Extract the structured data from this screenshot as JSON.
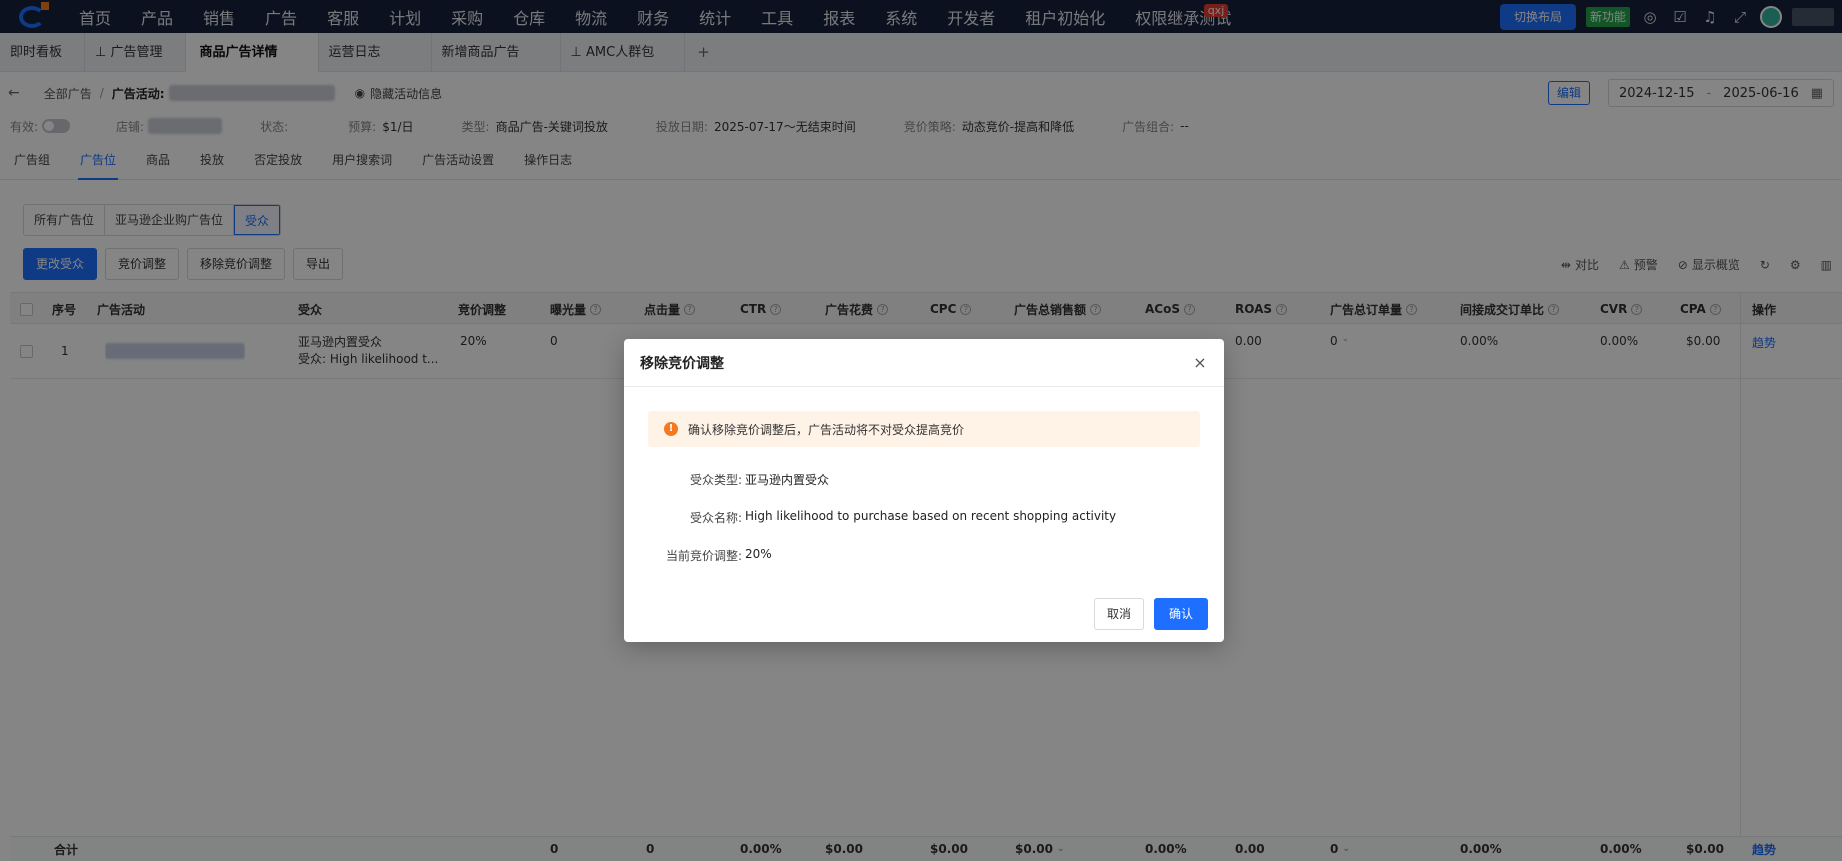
{
  "topnav": {
    "items": [
      "首页",
      "产品",
      "销售",
      "广告",
      "客服",
      "计划",
      "采购",
      "仓库",
      "物流",
      "财务",
      "统计",
      "工具",
      "报表",
      "系统",
      "开发者",
      "租户初始化",
      "权限继承测试"
    ],
    "badge": "qxj",
    "switch_layout": "切换布局",
    "new_feature": "新功能"
  },
  "tabs": [
    {
      "label": "即时看板"
    },
    {
      "label": "广告管理"
    },
    {
      "label": "商品广告详情"
    },
    {
      "label": "运营日志"
    },
    {
      "label": "新增商品广告"
    },
    {
      "label": "AMC人群包"
    }
  ],
  "tab_plus": "+",
  "breadcrumb": {
    "back": "←",
    "all_ads": "全部广告",
    "sep": "/",
    "campaign_label": "广告活动:",
    "hide_info": "隐藏活动信息",
    "edit": "编辑",
    "date_start": "2024-12-15",
    "date_sep": "-",
    "date_end": "2025-06-16"
  },
  "info": {
    "valid_label": "有效:",
    "shop_label": "店铺:",
    "status_label": "状态:",
    "budget_label": "预算:",
    "budget": "$1/日",
    "type_label": "类型:",
    "type": "商品广告-关键词投放",
    "date_label": "投放日期:",
    "date": "2025-07-17～无结束时间",
    "strategy_label": "竞价策略:",
    "strategy": "动态竞价-提高和降低",
    "portfolio_label": "广告组合:",
    "portfolio": "--"
  },
  "subtabs": [
    "广告组",
    "广告位",
    "商品",
    "投放",
    "否定投放",
    "用户搜索词",
    "广告活动设置",
    "操作日志"
  ],
  "segments": [
    "所有广告位",
    "亚马逊企业购广告位",
    "受众"
  ],
  "toolbar": {
    "change_audience": "更改受众",
    "bid_adjust": "竞价调整",
    "remove_bid_adjust": "移除竞价调整",
    "export": "导出",
    "compare": "对比",
    "alert": "预警",
    "show_overview": "显示概览"
  },
  "table": {
    "headers": [
      "序号",
      "广告活动",
      "受众",
      "竞价调整",
      "曝光量",
      "点击量",
      "CTR",
      "广告花费",
      "CPC",
      "广告总销售额",
      "ACoS",
      "ROAS",
      "广告总订单量",
      "间接成交订单比",
      "CVR",
      "CPA",
      "操作"
    ],
    "row": {
      "index": "1",
      "audience_type": "亚马逊内置受众",
      "audience_name": "受众: High likelihood t...",
      "bid": "20%",
      "impressions": "0",
      "roas": "0.00",
      "orders": "0",
      "indirect": "0.00%",
      "cvr": "0.00%",
      "cpa": "$0.00",
      "trend": "趋势"
    },
    "footer": {
      "label": "合计",
      "impressions": "0",
      "clicks": "0",
      "ctr": "0.00%",
      "spend": "$0.00",
      "cpc": "$0.00",
      "sales": "$0.00",
      "acos": "0.00%",
      "roas": "0.00",
      "orders": "0",
      "indirect": "0.00%",
      "cvr": "0.00%",
      "cpa": "$0.00",
      "trend": "趋势"
    }
  },
  "modal": {
    "title": "移除竞价调整",
    "close": "×",
    "warning": "确认移除竞价调整后，广告活动将不对受众提高竞价",
    "audience_type_label": "受众类型:",
    "audience_type": "亚马逊内置受众",
    "audience_name_label": "受众名称:",
    "audience_name": "High likelihood to purchase based on recent shopping activity",
    "current_bid_label": "当前竞价调整:",
    "current_bid": "20%",
    "cancel": "取消",
    "confirm": "确认"
  }
}
